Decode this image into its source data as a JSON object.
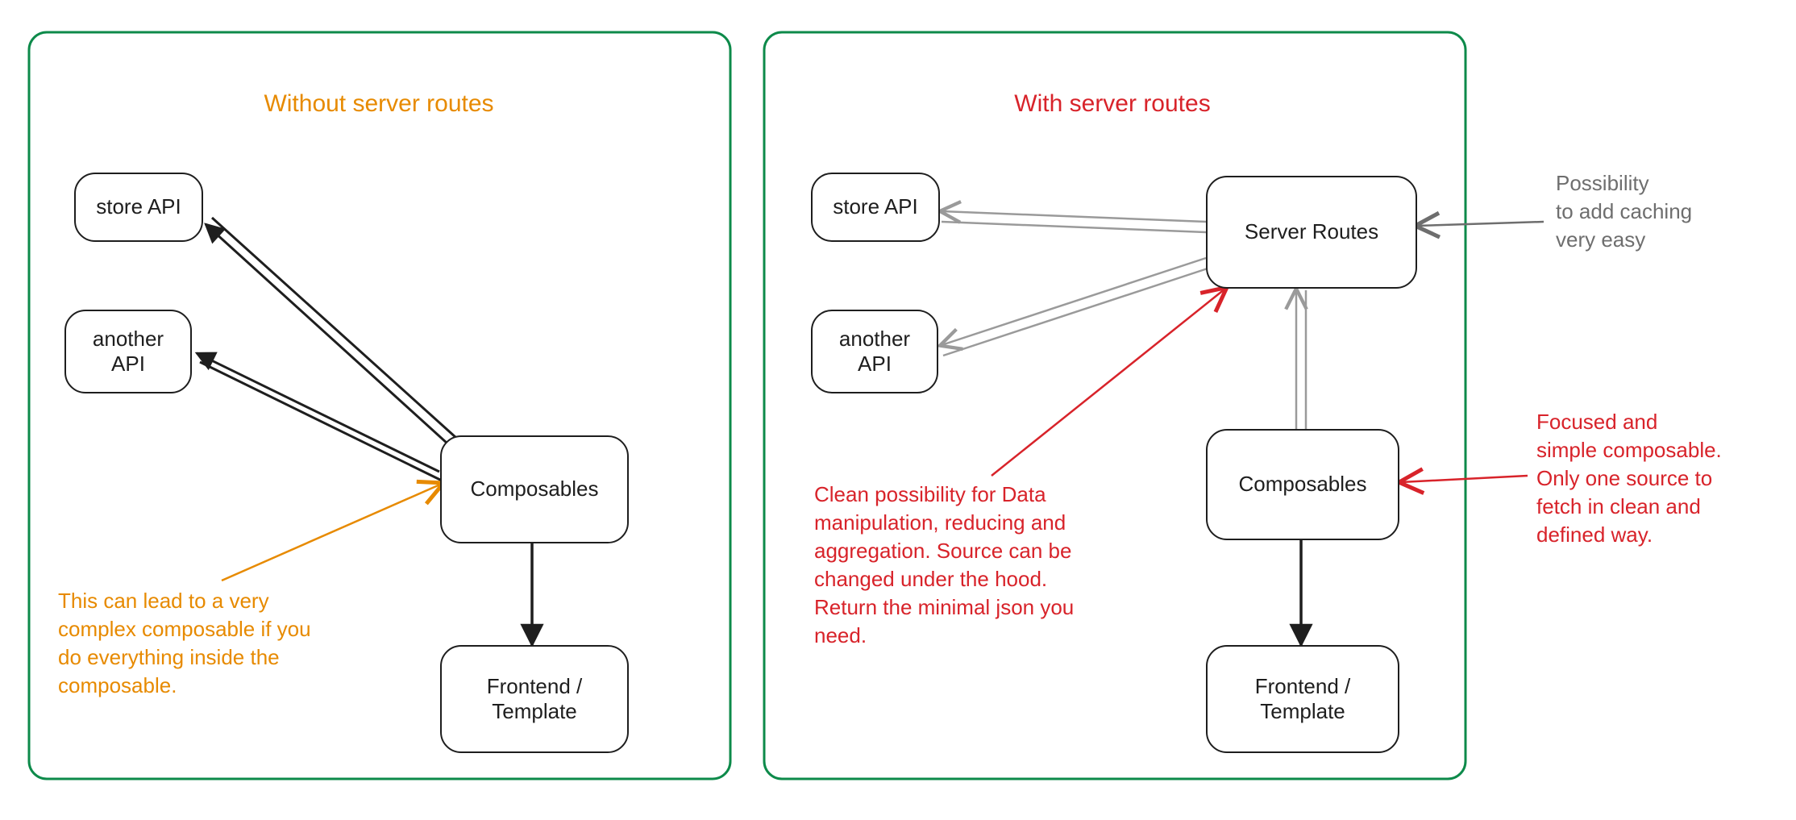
{
  "panels": {
    "left": {
      "title": "Without server routes"
    },
    "right": {
      "title": "With server routes"
    }
  },
  "nodes": {
    "left_store_api": "store API",
    "left_another_api": "another\nAPI",
    "left_composables": "Composables",
    "left_frontend": "Frontend /\nTemplate",
    "right_store_api": "store API",
    "right_another_api": "another\nAPI",
    "right_server_routes": "Server Routes",
    "right_composables": "Composables",
    "right_frontend": "Frontend /\nTemplate"
  },
  "annotations": {
    "left_complex": "This can lead to a very\ncomplex composable if you\ndo everything inside the\ncomposable.",
    "right_clean": "Clean possibility for Data\nmanipulation, reducing and\naggregation. Source can be\nchanged under the hood.\nReturn the minimal json you\nneed.",
    "right_focused": "Focused and\nsimple composable.\nOnly one source to\nfetch in clean and\ndefined way.",
    "right_caching": "Possibility\nto add caching\nvery easy"
  },
  "colors": {
    "green": "#0d8a4a",
    "orange": "#e78a00",
    "red": "#d8232a",
    "grey": "#6e6e6e",
    "black": "#1e1e1e"
  }
}
